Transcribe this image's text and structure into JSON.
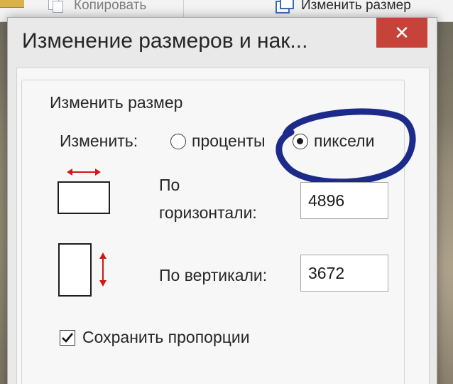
{
  "ribbon": {
    "copy_label": "Копировать",
    "resize_label": "Изменить размер"
  },
  "dialog": {
    "title": "Изменение размеров и нак...",
    "close_glyph": "✕"
  },
  "resize_group": {
    "title": "Изменить размер",
    "by_label": "Изменить:",
    "unit_options": [
      {
        "label": "проценты",
        "selected": false
      },
      {
        "label": "пиксели",
        "selected": true
      }
    ],
    "horizontal_label_line1": "По",
    "horizontal_label_line2": "горизонтали:",
    "horizontal_value": "4896",
    "vertical_label": "По вертикали:",
    "vertical_value": "3672",
    "keep_ratio_label": "Сохранить пропорции",
    "keep_ratio_checked": true
  },
  "colors": {
    "close_button": "#c7433a",
    "annotation_ink": "#1c2a8a",
    "arrow_red": "#d01818"
  },
  "icons": {
    "copy": "copy-icon",
    "resize": "resize-icon",
    "horizontal": "horizontal-resize-icon",
    "vertical": "vertical-resize-icon",
    "check": "checkmark-icon"
  }
}
